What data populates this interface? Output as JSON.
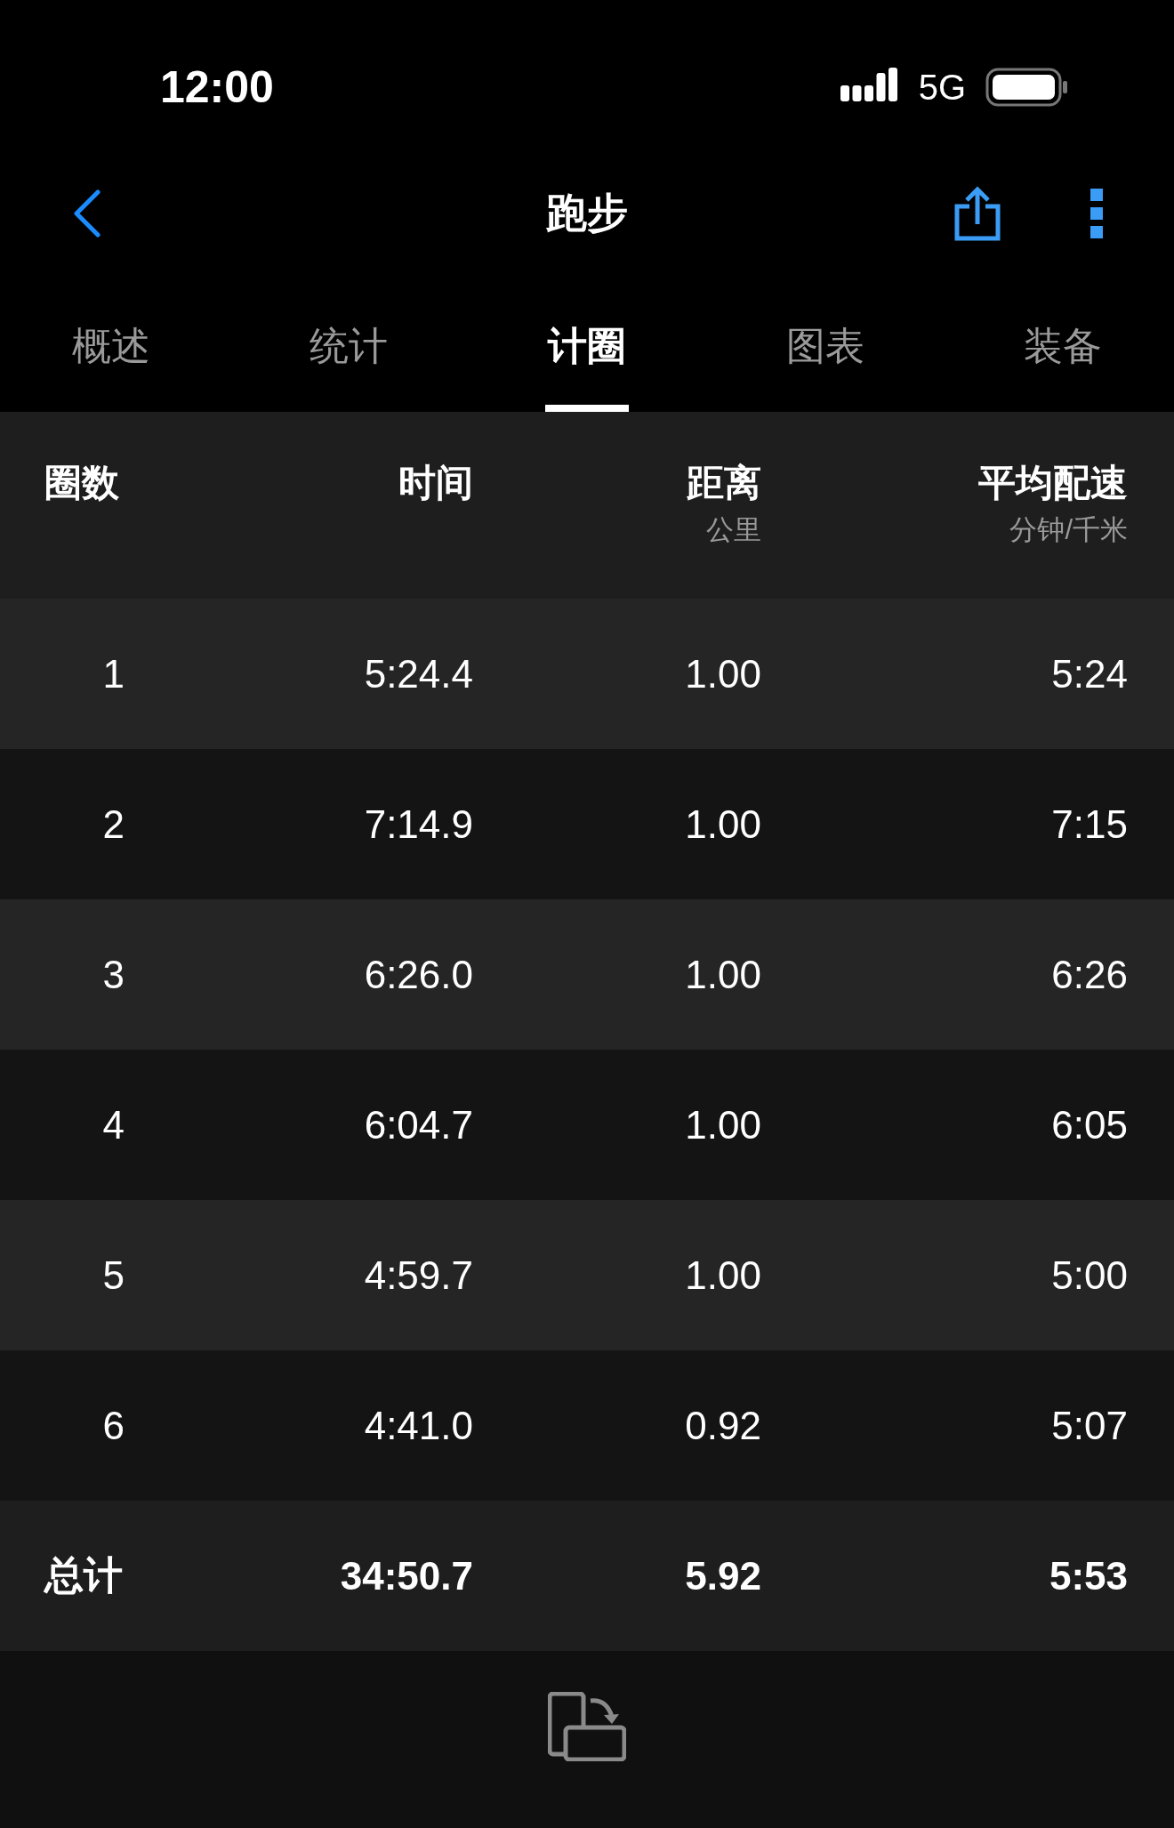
{
  "status_bar": {
    "time": "12:00",
    "network": "5G"
  },
  "nav": {
    "title": "跑步"
  },
  "tabs": [
    {
      "label": "概述",
      "selected": false
    },
    {
      "label": "统计",
      "selected": false
    },
    {
      "label": "计圈",
      "selected": true
    },
    {
      "label": "图表",
      "selected": false
    },
    {
      "label": "装备",
      "selected": false
    }
  ],
  "table": {
    "columns": [
      {
        "label": "圈数"
      },
      {
        "label": "时间"
      },
      {
        "label": "距离",
        "unit": "公里"
      },
      {
        "label": "平均配速",
        "unit": "分钟/千米"
      }
    ],
    "rows": [
      {
        "kind": "lap",
        "cells": [
          "1",
          "5:24.4",
          "1.00",
          "5:24"
        ]
      },
      {
        "kind": "lap",
        "cells": [
          "2",
          "7:14.9",
          "1.00",
          "7:15"
        ]
      },
      {
        "kind": "lap",
        "cells": [
          "3",
          "6:26.0",
          "1.00",
          "6:26"
        ]
      },
      {
        "kind": "lap",
        "cells": [
          "4",
          "6:04.7",
          "1.00",
          "6:05"
        ]
      },
      {
        "kind": "lap",
        "cells": [
          "5",
          "4:59.7",
          "1.00",
          "5:00"
        ]
      },
      {
        "kind": "lap",
        "cells": [
          "6",
          "4:41.0",
          "0.92",
          "5:07"
        ]
      },
      {
        "kind": "total",
        "cells": [
          "总计",
          "34:50.7",
          "5.92",
          "5:53"
        ]
      }
    ]
  }
}
